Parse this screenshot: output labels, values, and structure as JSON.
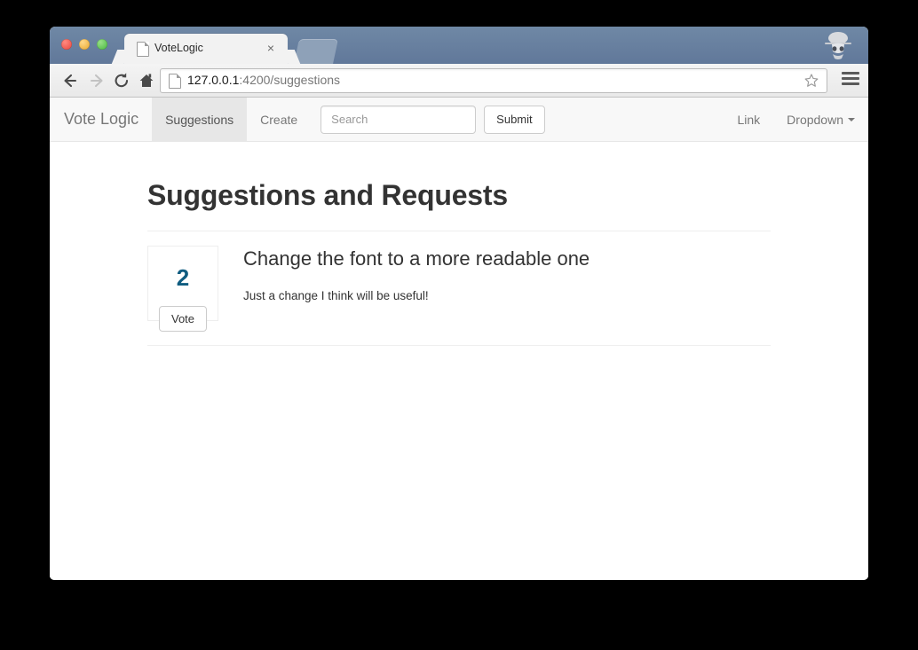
{
  "browser": {
    "tab": {
      "title": "VoteLogic",
      "close_label": "×",
      "page_icon": "page-icon"
    },
    "new_tab_label": "",
    "incognito_icon": "incognito-icon",
    "toolbar": {
      "back_icon": "back-arrow-icon",
      "forward_icon": "forward-arrow-icon",
      "reload_icon": "reload-icon",
      "home_icon": "home-icon",
      "bookmark_icon": "star-icon",
      "menu_icon": "hamburger-menu-icon"
    },
    "address": {
      "host": "127.0.0.1",
      "path": ":4200/suggestions"
    },
    "window_controls": {
      "close": "close",
      "minimize": "minimize",
      "maximize": "maximize"
    }
  },
  "navbar": {
    "brand": "Vote Logic",
    "links": [
      {
        "label": "Suggestions",
        "active": true
      },
      {
        "label": "Create",
        "active": false
      }
    ],
    "search": {
      "placeholder": "Search",
      "value": ""
    },
    "submit_label": "Submit",
    "right_links": [
      {
        "label": "Link",
        "caret": false
      },
      {
        "label": "Dropdown",
        "caret": true
      }
    ]
  },
  "page": {
    "title": "Suggestions and Requests",
    "suggestions": [
      {
        "votes": "2",
        "vote_button_label": "Vote",
        "title": "Change the font to a more readable one",
        "description": "Just a change I think will be useful!"
      }
    ]
  },
  "colors": {
    "vote_count": "#0f5c80",
    "navbar_bg": "#f8f8f8",
    "navbar_active_bg": "#e7e7e7",
    "chrome_titlebar": "#61789a"
  }
}
